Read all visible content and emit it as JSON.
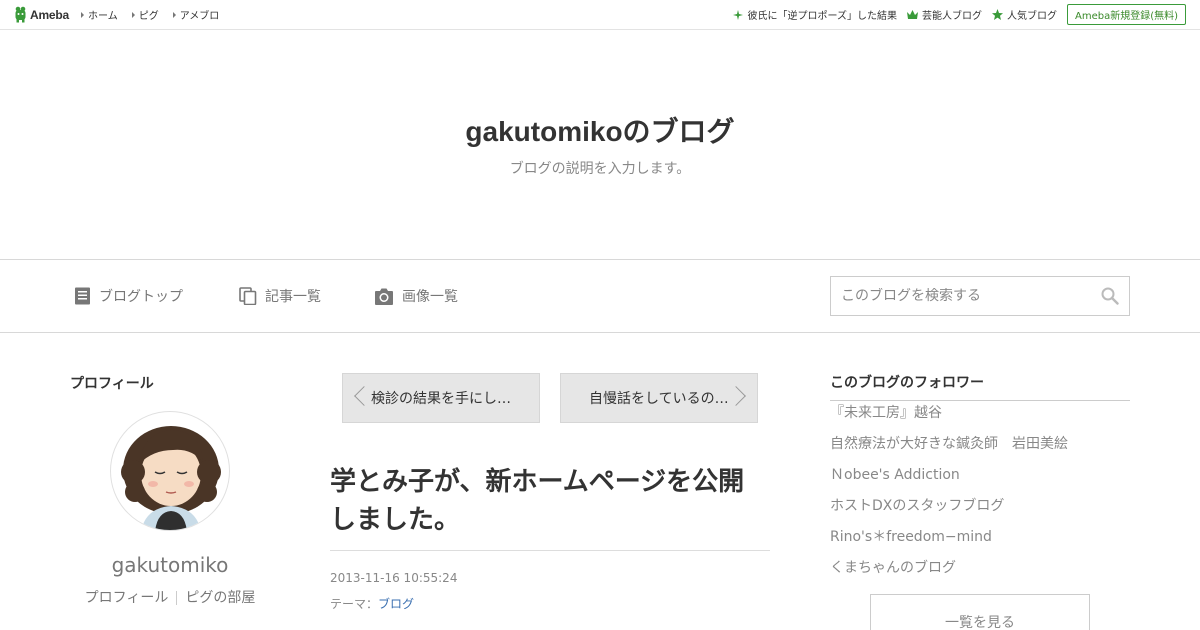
{
  "topbar": {
    "logo_text": "Ameba",
    "nav": [
      {
        "label": "ホーム"
      },
      {
        "label": "ピグ"
      },
      {
        "label": "アメブロ"
      }
    ],
    "right_links": [
      {
        "label": "彼氏に「逆プロポーズ」した結果",
        "icon": "sparkle-icon"
      },
      {
        "label": "芸能人ブログ",
        "icon": "crown-icon"
      },
      {
        "label": "人気ブログ",
        "icon": "star-icon"
      }
    ],
    "register_label": "Ameba新規登録(無料)"
  },
  "header": {
    "title": "gakutomikoのブログ",
    "description": "ブログの説明を入力します。"
  },
  "nav": {
    "items": [
      {
        "label": "ブログトップ",
        "icon": "document-icon"
      },
      {
        "label": "記事一覧",
        "icon": "copy-icon"
      },
      {
        "label": "画像一覧",
        "icon": "camera-icon"
      }
    ],
    "search_placeholder": "このブログを検索する"
  },
  "profile": {
    "section_title": "プロフィール",
    "username": "gakutomiko",
    "links": [
      "プロフィール",
      "ピグの部屋"
    ]
  },
  "article": {
    "prev_label": "検診の結果を手にし…",
    "next_label": "自慢話をしているの…",
    "title": "学とみ子が、新ホームページを公開しました。",
    "date": "2013-11-16 10:55:24",
    "theme_prefix": "テーマ：",
    "theme": "ブログ"
  },
  "followers": {
    "title": "このブログのフォロワー",
    "items": [
      "『未来工房』越谷",
      "自然療法が大好きな鍼灸師　岩田美絵",
      "Ｎobee's Addiction",
      "ホストDXのスタッフブログ",
      "Rino's＊freedom−mind",
      "くまちゃんのブログ"
    ],
    "see_all_label": "一覧を見る"
  },
  "colors": {
    "brand_green": "#3a9b3a",
    "link_blue": "#3a6fb0"
  }
}
